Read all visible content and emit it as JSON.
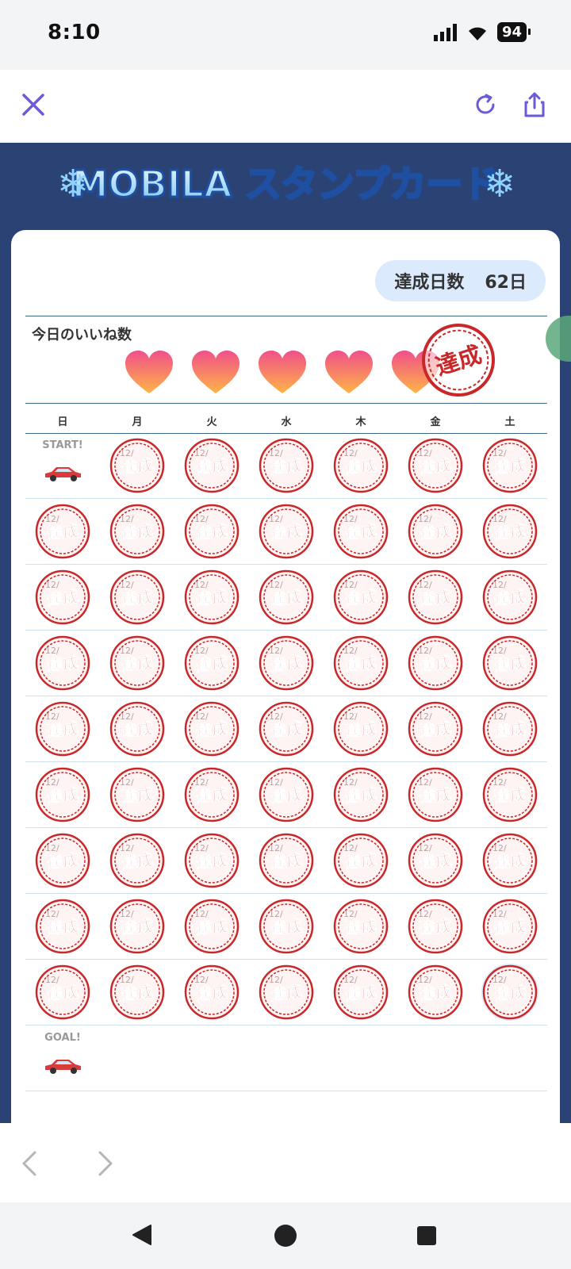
{
  "status_bar": {
    "time": "8:10",
    "battery": "94"
  },
  "toolbar": {
    "close_icon": "close-icon",
    "reload_icon": "reload-icon",
    "share_icon": "share-icon"
  },
  "header": {
    "logo_text": "MOBILA スタンプカード"
  },
  "summary": {
    "days_label": "達成日数",
    "days_value": "62日"
  },
  "likes": {
    "label": "今日のいいね数",
    "hearts": 5,
    "achieved_stamp": "達成"
  },
  "calendar": {
    "weekdays": [
      "日",
      "月",
      "火",
      "水",
      "木",
      "金",
      "土"
    ],
    "start_label": "START!",
    "goal_label": "GOAL!",
    "stamp_text": "達成",
    "rows": 9,
    "stamps_total": 62
  },
  "bottom_nav": {
    "back_icon": "chevron-left-icon",
    "forward_icon": "chevron-right-icon"
  },
  "colors": {
    "accent": "#6a5bd6",
    "banner": "#2b4275",
    "stamp_red": "#c8282a",
    "pill": "#dbeafc"
  }
}
